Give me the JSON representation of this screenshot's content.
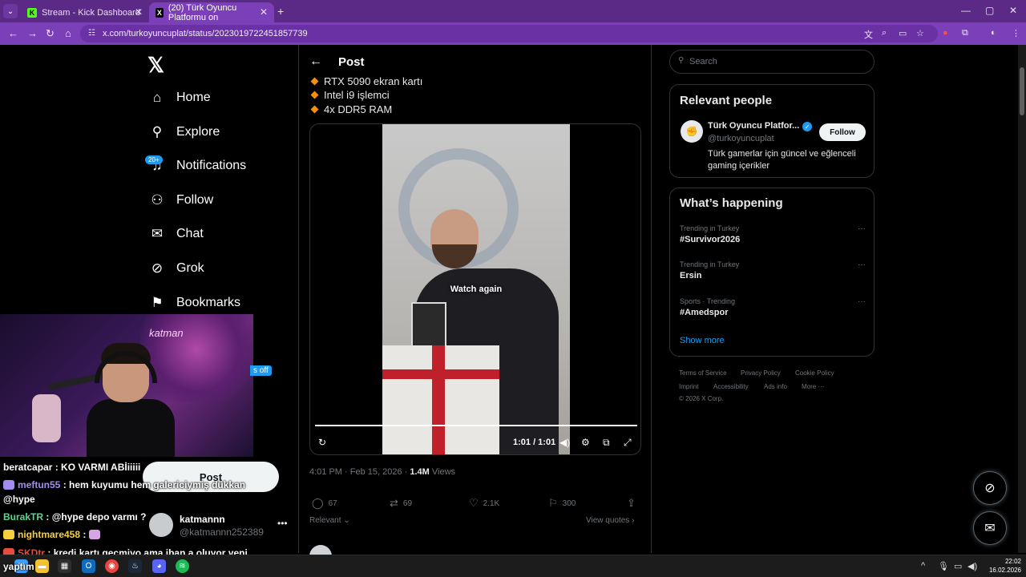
{
  "browser": {
    "tabs": [
      {
        "label": "Stream - Kick Dashboard",
        "favicon": "K",
        "favicon_color": "#53fc18"
      },
      {
        "label": "(20) Türk Oyuncu Platformu on",
        "favicon": "X",
        "favicon_color": "#000000"
      }
    ],
    "url": "x.com/turkoyuncuplat/status/2023019722451857739"
  },
  "sidebar": {
    "items": [
      {
        "label": "Home",
        "icon": "home-icon"
      },
      {
        "label": "Explore",
        "icon": "search-icon"
      },
      {
        "label": "Notifications",
        "icon": "bell-icon",
        "badge": "20+"
      },
      {
        "label": "Follow",
        "icon": "person-plus-icon"
      },
      {
        "label": "Chat",
        "icon": "mail-icon"
      },
      {
        "label": "Grok",
        "icon": "grok-icon"
      },
      {
        "label": "Bookmarks",
        "icon": "bookmark-icon"
      }
    ],
    "post_label": "Post",
    "account": {
      "name": "katmannn",
      "handle": "@katmannn252389"
    }
  },
  "webcam": {
    "neon_text": "katman",
    "badge_text": "s off"
  },
  "chat": [
    {
      "user": "beratcapar",
      "text": ": KO VARMI ABİiiiii",
      "color": "#ffffff"
    },
    {
      "user": "meftun55",
      "text": ": hem kuyumu hem galericiymiş dükkan",
      "color": "#a48bf0"
    },
    {
      "user": "",
      "text": "@hype",
      "color": "#ffffff"
    },
    {
      "user": "BurakTR",
      "text": ": @hype depo varmı ?",
      "color": "#58d68d"
    },
    {
      "user": "nightmare458",
      "text": ":",
      "color": "#f4d03f"
    },
    {
      "user": "SKDtr",
      "text": ": kredi kartı geçmiyo ama iban a oluyor yeni",
      "color": "#e74c3c"
    },
    {
      "user": "",
      "text": "yaptım",
      "color": "#ffffff"
    }
  ],
  "post": {
    "header": "Post",
    "bullets": [
      "RTX 5090 ekran kartı",
      "Intel i9 işlemci",
      "4x DDR5 RAM"
    ],
    "video": {
      "overlay": "Watch again",
      "time": "1:01 / 1:01",
      "progress": 1.0
    },
    "timestamp": "4:01 PM · Feb 15, 2026 · ",
    "views": "1.4M",
    "views_label": " Views",
    "actions": {
      "replies": "67",
      "reposts": "69",
      "likes": "2.1K",
      "bookmarks": "300"
    },
    "sort_label": "Relevant",
    "view_quotes": "View quotes"
  },
  "right": {
    "search_placeholder": "Search",
    "relevant_people": {
      "title": "Relevant people",
      "name": "Türk Oyuncu Platfor...",
      "handle": "@turkoyuncuplat",
      "bio": "Türk gamerlar için güncel ve eğlenceli gaming içerikler",
      "follow_label": "Follow"
    },
    "happening": {
      "title": "What’s happening",
      "trends": [
        {
          "category": "Trending in Turkey",
          "name": "#Survivor2026"
        },
        {
          "category": "Trending in Turkey",
          "name": "Ersin"
        },
        {
          "category": "Sports · Trending",
          "name": "#Amedspor"
        }
      ],
      "show_more": "Show more"
    },
    "footer": {
      "row1": [
        "Terms of Service",
        "Privacy Policy",
        "Cookie Policy"
      ],
      "row2": [
        "Imprint",
        "Accessibility",
        "Ads info",
        "More ···"
      ],
      "copyright": "© 2026 X Corp."
    }
  },
  "taskbar": {
    "time": "22:02",
    "date": "16.02.2026"
  },
  "colors": {
    "accent": "#1d9bf0",
    "browser_frame": "#7b3fb8"
  }
}
